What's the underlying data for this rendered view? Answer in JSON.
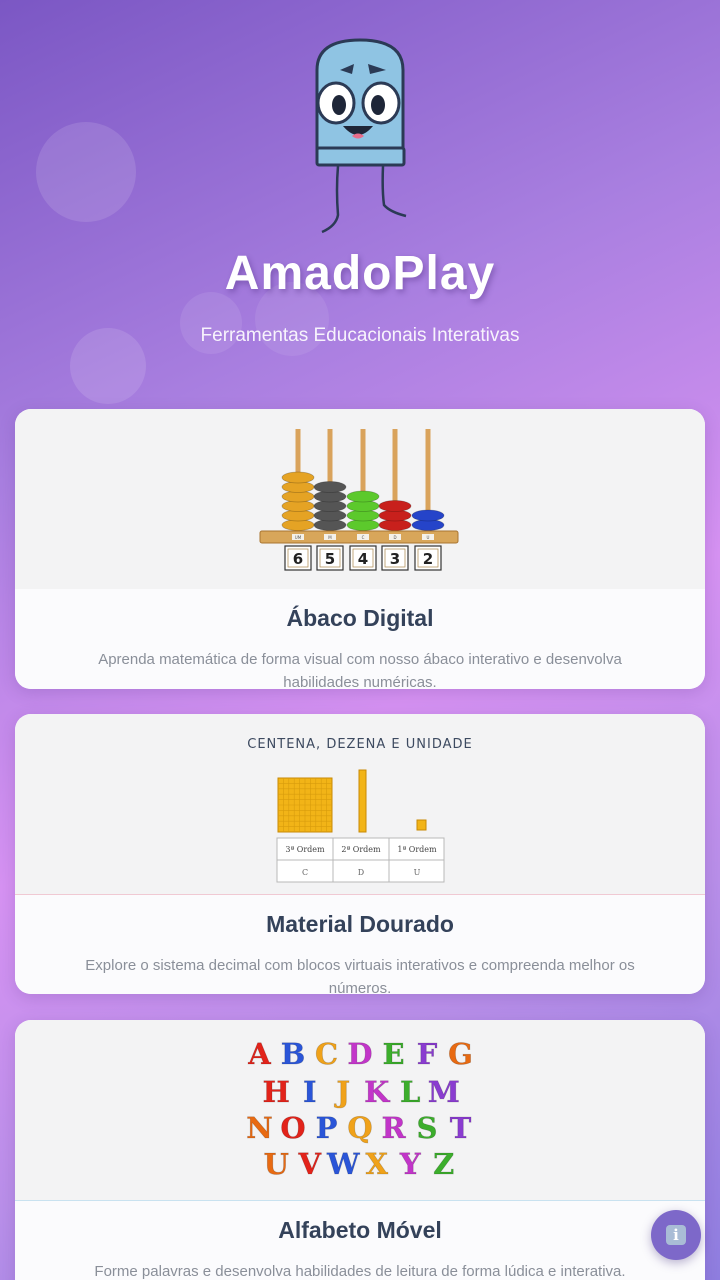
{
  "header": {
    "app_title": "AmadoPlay",
    "subtitle": "Ferramentas Educacionais Interativas"
  },
  "cards": [
    {
      "title": "Ábaco Digital",
      "description": "Aprenda matemática de forma visual com nosso ábaco interativo e desenvolva habilidades numéricas.",
      "art": {
        "digits": [
          "6",
          "5",
          "4",
          "3",
          "2"
        ],
        "rod_labels": [
          "UM",
          "M",
          "C",
          "D",
          "U"
        ],
        "bead_colors": [
          "#e5a324",
          "#555555",
          "#5cc92c",
          "#c8201c",
          "#2544c9"
        ],
        "bead_counts": [
          6,
          5,
          4,
          3,
          2
        ]
      }
    },
    {
      "title": "Material Dourado",
      "description": "Explore o sistema decimal com blocos virtuais interativos e compreenda melhor os números.",
      "art": {
        "heading": "CENTENA, DEZENA E UNIDADE",
        "order_labels": [
          "3ª Ordem",
          "2ª Ordem",
          "1ª Ordem"
        ],
        "place_letters": [
          "C",
          "D",
          "U"
        ]
      }
    },
    {
      "title": "Alfabeto Móvel",
      "description": "Forme palavras e desenvolva habilidades de leitura de forma lúdica e interativa.",
      "art": {
        "rows": [
          [
            "A",
            "B",
            "C",
            "D",
            "E",
            "F",
            "G"
          ],
          [
            "H",
            "I",
            "J",
            "K",
            "L",
            "M"
          ],
          [
            "N",
            "O",
            "P",
            "Q",
            "R",
            "S",
            "T"
          ],
          [
            "U",
            "V",
            "W",
            "X",
            "Y",
            "Z"
          ]
        ],
        "letter_colors": [
          "#e2231a",
          "#2a55d8",
          "#f0a21a",
          "#c235c9",
          "#3cae2c",
          "#8a3cd0",
          "#e86a12"
        ]
      }
    }
  ],
  "info_button": {
    "icon": "info-icon",
    "glyph": "i"
  }
}
